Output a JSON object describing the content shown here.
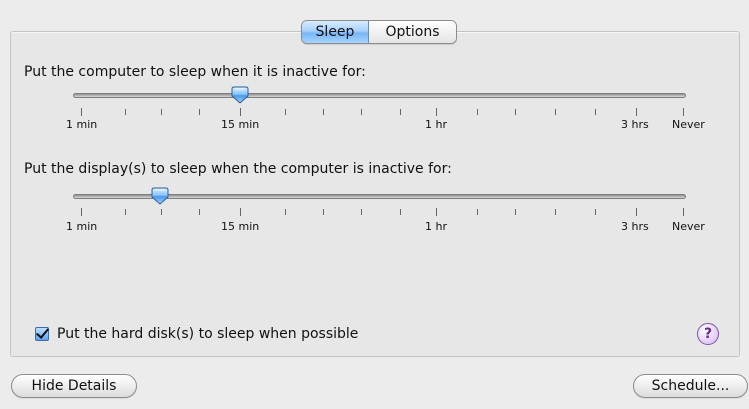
{
  "tabs": {
    "sleep_label": "Sleep",
    "options_label": "Options"
  },
  "computer_sleep": {
    "label": "Put the computer to sleep when it is inactive for:",
    "slider_value": "15 min",
    "tick_labels": [
      "1 min",
      "15 min",
      "1 hr",
      "3 hrs",
      "Never"
    ]
  },
  "display_sleep": {
    "label": "Put the display(s) to sleep when the computer is inactive for:",
    "slider_value": "between 1 min and 15 min",
    "tick_labels": [
      "1 min",
      "15 min",
      "1 hr",
      "3 hrs",
      "Never"
    ]
  },
  "hard_disk": {
    "label": "Put the hard disk(s) to sleep when possible",
    "checked": true
  },
  "help": {
    "symbol": "?"
  },
  "buttons": {
    "hide_details": "Hide Details",
    "schedule": "Schedule..."
  },
  "colors": {
    "accent_blue": "#79b5f5",
    "help_purple": "#7c52a6"
  }
}
